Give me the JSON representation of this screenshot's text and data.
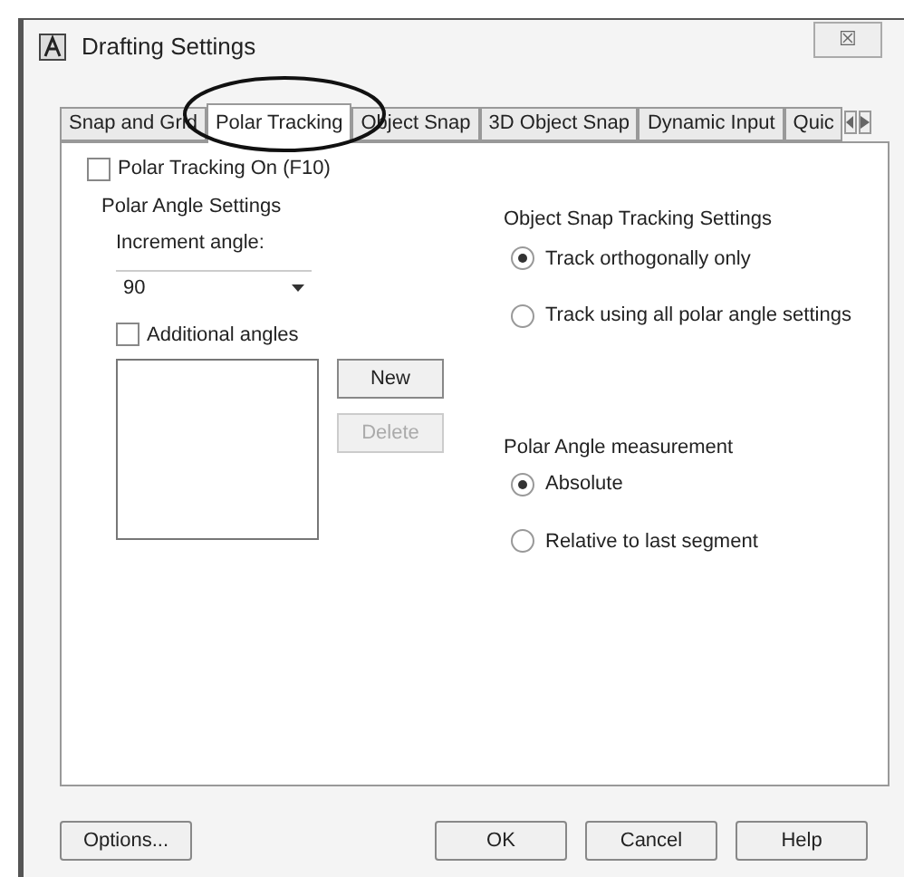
{
  "window": {
    "title": "Drafting Settings",
    "close": "☒"
  },
  "tabs": [
    {
      "label": "Snap and Grid",
      "selected": false
    },
    {
      "label": "Polar Tracking",
      "selected": true,
      "circled": true
    },
    {
      "label": "Object Snap",
      "selected": false
    },
    {
      "label": "3D Object Snap",
      "selected": false
    },
    {
      "label": "Dynamic Input",
      "selected": false
    },
    {
      "label": "Quic",
      "selected": false
    }
  ],
  "polar_tracking_on": {
    "label": "Polar Tracking On (F10)",
    "checked": false
  },
  "polar_angle_settings": {
    "title": "Polar Angle Settings",
    "increment_label": "Increment angle:",
    "increment_value": "90",
    "additional_angles": {
      "label": "Additional angles",
      "checked": false
    },
    "buttons": [
      {
        "label": "New",
        "disabled": false
      },
      {
        "label": "Delete",
        "disabled": true
      }
    ]
  },
  "object_snap_tracking": {
    "title": "Object Snap Tracking Settings",
    "options": [
      {
        "label": "Track orthogonally only",
        "selected": true
      },
      {
        "label": "Track using all polar angle settings",
        "selected": false
      }
    ]
  },
  "polar_angle_measurement": {
    "title": "Polar Angle measurement",
    "options": [
      {
        "label": "Absolute",
        "selected": true
      },
      {
        "label": "Relative to last segment",
        "selected": false
      }
    ]
  },
  "footer_buttons": [
    {
      "label": "Options...",
      "kind": "left"
    },
    {
      "label": "OK",
      "kind": "right"
    },
    {
      "label": "Cancel",
      "kind": "right"
    },
    {
      "label": "Help",
      "kind": "right"
    }
  ]
}
